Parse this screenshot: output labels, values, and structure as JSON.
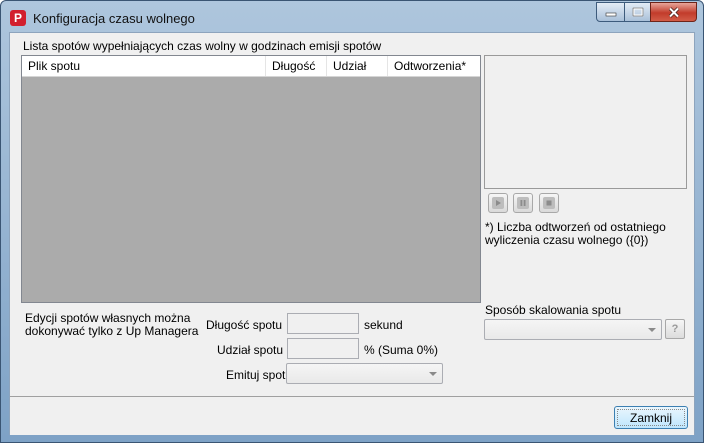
{
  "window": {
    "title": "Konfiguracja czasu wolnego",
    "app_icon_letter": "P"
  },
  "list": {
    "group_label": "Lista spotów wypełniających czas wolny w godzinach emisji spotów",
    "columns": [
      "Plik spotu",
      "Długość",
      "Udział",
      "Odtworzenia*"
    ]
  },
  "note": {
    "footnote_line1": "*) Liczba odtworzeń od ostatniego",
    "footnote_line2": "wyliczenia czasu wolnego ({0})",
    "edit_info_line1": "Edycji spotów własnych można",
    "edit_info_line2": "dokonywać tylko z Up Managera"
  },
  "form": {
    "length_label": "Długość spotu",
    "length_unit": "sekund",
    "share_label": "Udział spotu",
    "share_unit": "% (Suma 0%)",
    "emit_label": "Emituj spot",
    "scaling_label": "Sposób skalowania spotu",
    "help_label": "?"
  },
  "footer": {
    "close_label": "Zamknij"
  },
  "icons": {
    "window_buttons": [
      "minimize-icon",
      "maximize-icon",
      "close-icon"
    ],
    "media_buttons": [
      "play-icon",
      "pause-icon",
      "stop-icon"
    ]
  }
}
